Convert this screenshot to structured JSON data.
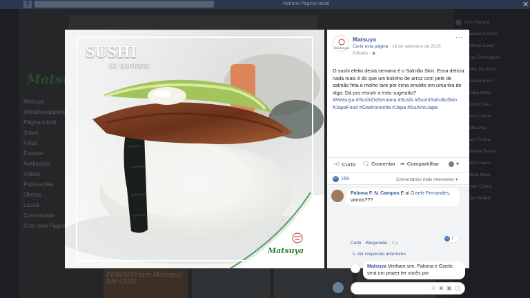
{
  "background": {
    "topbar": {
      "fb_logo": "f",
      "nav_text": "Adriano   Página inicial"
    },
    "left_brand": "Matsuya",
    "left_menu": [
      "Matsuya",
      "@matsuyajapanese",
      "Página inicial",
      "Sobre",
      "Fotos",
      "Eventos",
      "Avaliações",
      "Vídeos",
      "Publicações",
      "Ofertas",
      "Locais",
      "Comunidade",
      "Criar uma Página"
    ],
    "right_list": [
      "Vitor Sampa",
      "Eduardo Simões",
      "Matheus Lauer",
      "Lucas Domingues",
      "Carlos Da Silva",
      "Gustavo Brum",
      "Renata Alves",
      "Marcelo Dias",
      "Marta Coelho",
      "Carla Lima",
      "Paulo Rocha",
      "Vanessa Souza",
      "Pedro Lopes",
      "Juliana Mota",
      "Renan Castro",
      "Laura Beatriz"
    ],
    "poster_text": "FERIADO tem Matsuya! EM QUAL"
  },
  "photo": {
    "title_big": "SUSHI",
    "title_small": "da semana",
    "brand": "Matsuya"
  },
  "post": {
    "page_name": "Matsuya",
    "curtir_pagina": "Curtir esta página",
    "date": "16 de setembro de 2015",
    "edited": "Editado",
    "more": "···",
    "text": "O sushi eleito desta semana é o Salmão Skin. Essa delícia nada mais é do que um bolinho de arroz com pele de salmão frita e molho tare por cima envolto em uma tira de alga. Dá pra resistir a esta sugestão?",
    "hashtags": "#Matsuya #SushiDaSemana #Sushi #SushiSalmãoSkin #JapaFood #Gastronomia #Japa #EuAmoJapa",
    "actions": {
      "like": "Curtir",
      "comment": "Comentar",
      "share": "Compartilhar"
    },
    "like_count": "169",
    "sort_label": "Comentários mais relevantes ▾",
    "comments": [
      {
        "name": "Paloma F. N. Campos",
        "text_prefix": " E aí ",
        "mention": "Gisele Fernandes",
        "text_suffix": ", vamos???",
        "like_action": "Curtir",
        "reply_action": "Responder",
        "time": "2 a",
        "likes": "2"
      },
      {
        "name": "Matsuya",
        "text": " Venham sim, Paloma e Gisele, será um prazer ter vocês por"
      }
    ],
    "view_replies": "Ver respostas anteriores"
  },
  "colors": {
    "link": "#365899",
    "like_blue": "#4267b2",
    "brand_green": "#2f7d32"
  }
}
